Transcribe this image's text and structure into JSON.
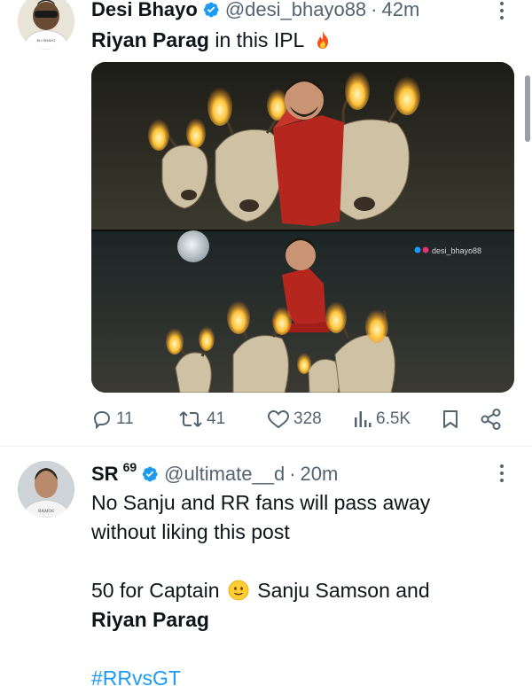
{
  "tweets": [
    {
      "display_name": "Desi Bhayo",
      "handle": "@desi_bhayo88",
      "separator": "·",
      "time": "42m",
      "text_bold": "Riyan Parag",
      "text_rest": " in this IPL",
      "text_emoji": "fire",
      "media_watermark": "desi_bhayo88",
      "stats": {
        "replies": "11",
        "retweets": "41",
        "likes": "328",
        "views": "6.5K"
      },
      "avatar_jersey_text": "ELI SHAYO"
    },
    {
      "display_name": "SR",
      "display_name_suffix": "69",
      "handle": "@ultimate__d",
      "separator": "·",
      "time": "20m",
      "line1": "No Sanju and RR fans will pass away",
      "line2": "without liking this post",
      "line3_start": "50 for Captain",
      "line3_emoji": "smiling face",
      "line3_end": "Sanju Samson and",
      "line4_bold": "Riyan Parag",
      "hashtag": "#RRvsGT",
      "avatar_jersey_text": "RAMOS"
    }
  ],
  "colors": {
    "text": "#0f1419",
    "secondary": "#536471",
    "verified": "#1d9bf0",
    "link": "#1d9bf0",
    "divider": "#eff3f4"
  },
  "icons": [
    "verified-badge-icon",
    "more-icon",
    "reply-icon",
    "retweet-icon",
    "like-icon",
    "views-icon",
    "bookmark-icon",
    "share-icon",
    "fire-emoji-icon",
    "smile-emoji-icon"
  ]
}
